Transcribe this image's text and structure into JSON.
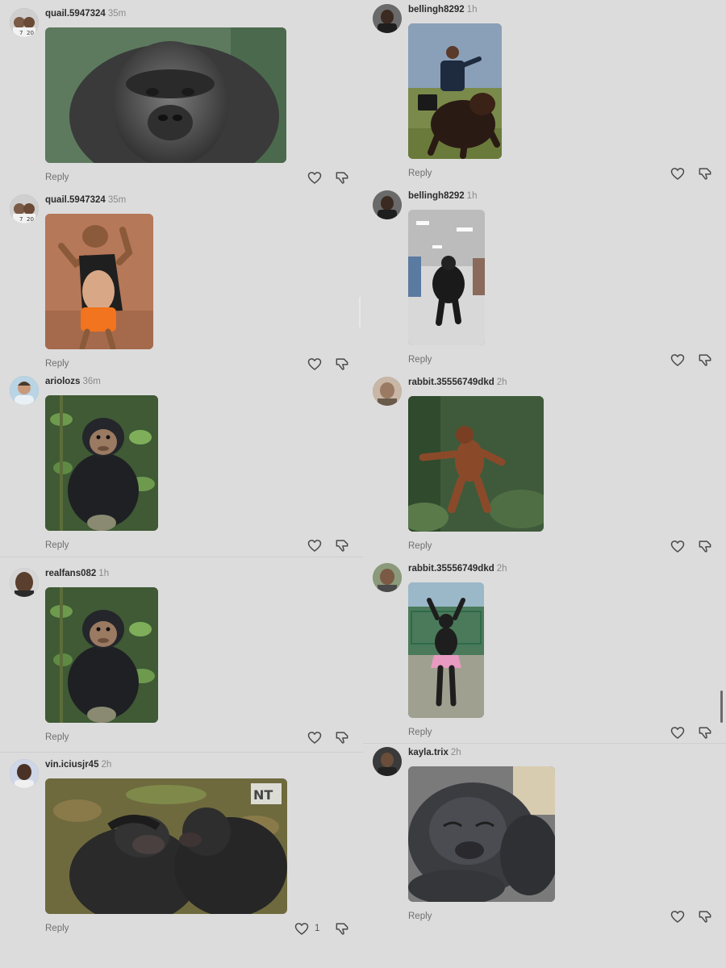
{
  "reply_label": "Reply",
  "colors": {
    "background": "#dcdcdc",
    "username": "#2b2b2b",
    "timestamp": "#8a8a8a",
    "reply": "#6f6f6f",
    "icon_stroke": "#4a4a4a"
  },
  "icons": {
    "like": "heart-icon",
    "dislike": "thumbs-down-icon"
  },
  "left_comments": [
    {
      "username": "quail.5947324",
      "time": "35m",
      "gif": "gorilla face close-up",
      "like_count": ""
    },
    {
      "username": "quail.5947324",
      "time": "35m",
      "gif": "monkey dancing in orange shorts",
      "like_count": ""
    },
    {
      "username": "ariolozs",
      "time": "36m",
      "gif": "baby chimpanzee in jungle",
      "like_count": ""
    },
    {
      "username": "realfans082",
      "time": "1h",
      "gif": "baby chimpanzee in jungle",
      "like_count": ""
    },
    {
      "username": "vin.iciusjr45",
      "time": "2h",
      "gif": "two chimpanzees",
      "like_count": "1"
    }
  ],
  "right_comments": [
    {
      "username": "bellingh8292",
      "time": "1h",
      "gif": "man in suit riding gorilla",
      "like_count": ""
    },
    {
      "username": "bellingh8292",
      "time": "1h",
      "gif": "gorilla in supermarket aisle",
      "like_count": ""
    },
    {
      "username": "rabbit.35556749dkd",
      "time": "2h",
      "gif": "orangutan dancing in forest",
      "like_count": ""
    },
    {
      "username": "rabbit.35556749dkd",
      "time": "2h",
      "gif": "gorilla in pink tutu",
      "like_count": ""
    },
    {
      "username": "kayla.trix",
      "time": "2h",
      "gif": "sleeping baby gorilla",
      "like_count": ""
    }
  ]
}
